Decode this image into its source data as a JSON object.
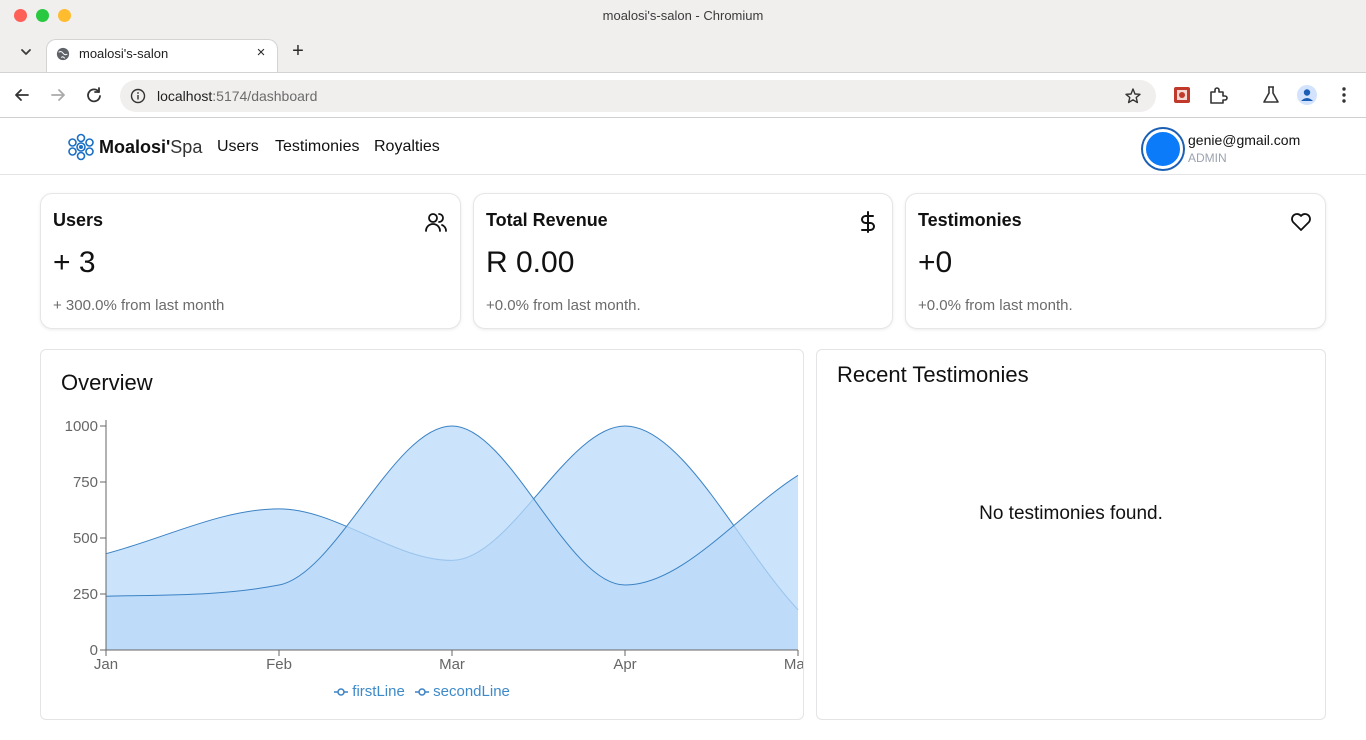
{
  "window": {
    "title": "moalosi's-salon - Chromium"
  },
  "tab": {
    "title": "moalosi's-salon",
    "close_label": "×",
    "new_tab_label": "+"
  },
  "omnibox": {
    "host": "localhost",
    "path": ":5174/dashboard"
  },
  "navbar": {
    "brand_bold": "Moalosi'",
    "brand_light": "Spa",
    "links": [
      "Users",
      "Testimonies",
      "Royalties"
    ],
    "user_email": "genie@gmail.com",
    "user_role": "ADMIN",
    "avatar_color": "#0b7bfa"
  },
  "cards": [
    {
      "title": "Users",
      "icon": "users-icon",
      "value": "+ 3",
      "sub": "+ 300.0% from last month"
    },
    {
      "title": "Total Revenue",
      "icon": "dollar-icon",
      "value": "R 0.00",
      "sub": "+0.0% from last month."
    },
    {
      "title": "Testimonies",
      "icon": "heart-icon",
      "value": "+0",
      "sub": "+0.0% from last month."
    }
  ],
  "overview": {
    "title": "Overview"
  },
  "recent": {
    "title": "Recent Testimonies",
    "empty": "No testimonies found."
  },
  "chart_data": {
    "type": "area",
    "categories": [
      "Jan",
      "Feb",
      "Mar",
      "Apr",
      "May"
    ],
    "series": [
      {
        "name": "firstLine",
        "values": [
          430,
          630,
          400,
          1000,
          180
        ]
      },
      {
        "name": "secondLine",
        "values": [
          240,
          290,
          1000,
          290,
          780
        ]
      }
    ],
    "ylim": [
      0,
      1000
    ],
    "yticks": [
      0,
      250,
      500,
      750,
      1000
    ],
    "fill_color": "#b9d9f9",
    "stroke_color": "#3b82c4",
    "legend": "bottom",
    "grid": false
  }
}
